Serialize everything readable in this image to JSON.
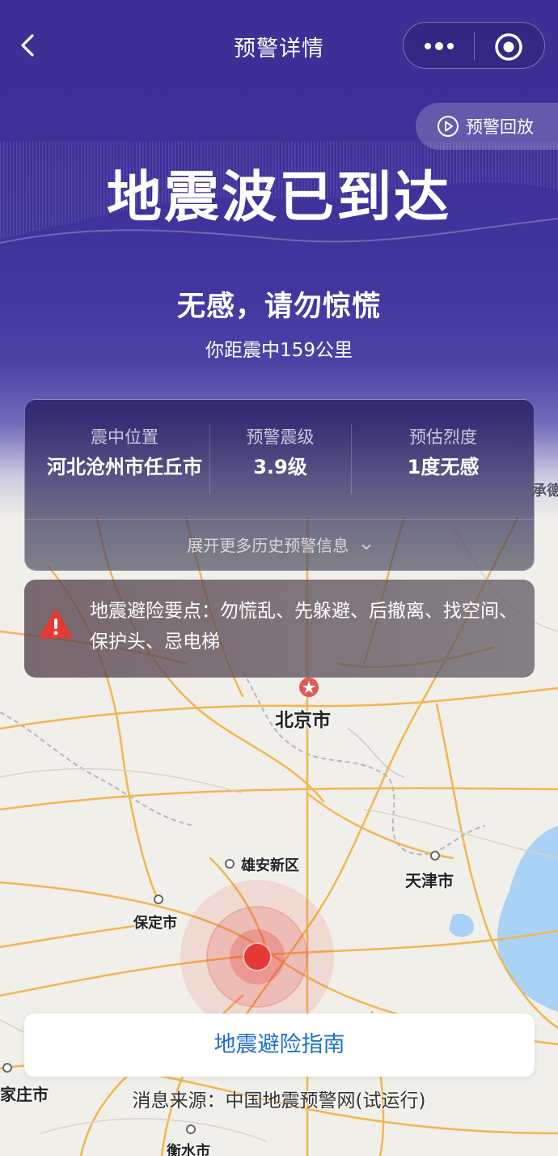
{
  "nav": {
    "title": "预警详情",
    "back_icon": "chevron-left-icon",
    "more_icon": "more-dots-icon",
    "close_icon": "target-circle-icon"
  },
  "replay": {
    "label": "预警回放",
    "icon": "play-circle-icon"
  },
  "hero": {
    "title": "地震波已到达",
    "subtitle": "无感，请勿惊慌",
    "distance": "你距震中159公里"
  },
  "info": {
    "epicenter_label": "震中位置",
    "epicenter_value": "河北沧州市任丘市",
    "magnitude_label": "预警震级",
    "magnitude_value": "3.9级",
    "intensity_label": "预估烈度",
    "intensity_value": "1度无感",
    "expand_label": "展开更多历史预警信息"
  },
  "tips": {
    "icon": "warning-triangle-icon",
    "text": "地震避险要点：勿慌乱、先躲避、后撤离、找空间、保护头、忌电梯"
  },
  "map": {
    "cities": {
      "beijing": "北京市",
      "xiongan": "雄安新区",
      "tianjin": "天津市",
      "baoding": "保定市",
      "chengde": "承德",
      "shijiazhuang": "家庄市",
      "hengshui": "衡水市"
    }
  },
  "guide_button": "地震避险指南",
  "source": "消息来源：中国地震预警网(试运行)",
  "colors": {
    "header": "#3c2f95",
    "epicenter": "#e53935",
    "link": "#1f6fd1",
    "warning": "#e53935"
  }
}
